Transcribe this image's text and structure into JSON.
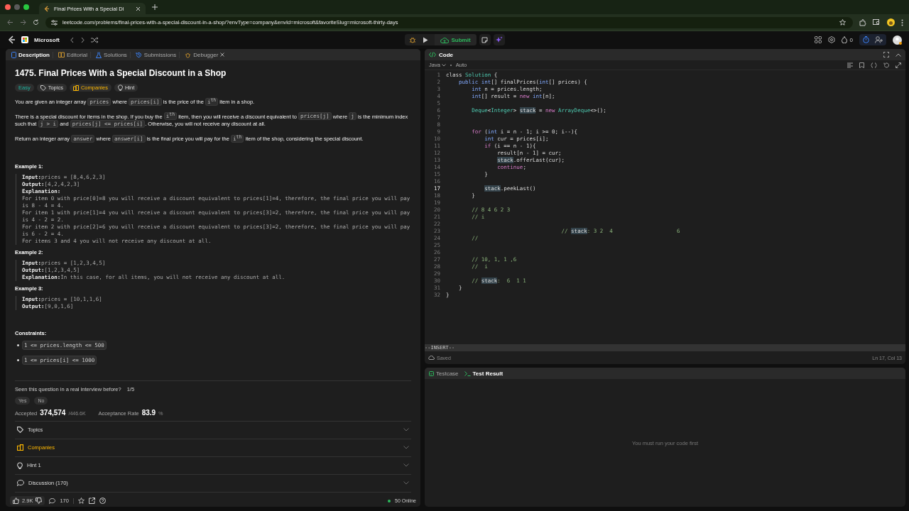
{
  "browser": {
    "tab_title": "Final Prices With a Special Di",
    "url": "leetcode.com/problems/final-prices-with-a-special-discount-in-a-shop/?envType=company&envId=microsoft&favoriteSlug=microsoft-thirty-days"
  },
  "app_bar": {
    "list_name": "Microsoft",
    "submit": "Submit",
    "points": "0"
  },
  "left_tabs": [
    {
      "label": "Description",
      "selected": true,
      "kind": "description"
    },
    {
      "label": "Editorial",
      "selected": false,
      "kind": "editorial"
    },
    {
      "label": "Solutions",
      "selected": false,
      "kind": "solutions"
    },
    {
      "label": "Submissions",
      "selected": false,
      "kind": "submissions"
    },
    {
      "label": "Debugger",
      "selected": false,
      "kind": "debugger"
    }
  ],
  "problem": {
    "title": "1475. Final Prices With a Special Discount in a Shop",
    "difficulty": "Easy",
    "tags": [
      {
        "label": "Topics",
        "kind": "topics"
      },
      {
        "label": "Companies",
        "kind": "companies"
      },
      {
        "label": "Hint",
        "kind": "hint"
      }
    ],
    "paragraphs": [
      [
        {
          "t": "You are given an integer array "
        },
        {
          "t": "prices",
          "code": true
        },
        {
          "t": " where "
        },
        {
          "t": "prices[i]",
          "code": true
        },
        {
          "t": " is the price of the "
        },
        {
          "t": "i$^{th}$",
          "code": true
        },
        {
          "t": " item in a shop."
        }
      ],
      [
        {
          "t": "There is a special discount for items in the shop. If you buy the "
        },
        {
          "t": "i$^{th}$",
          "code": true
        },
        {
          "t": " item, then you will receive a discount equivalent to "
        },
        {
          "t": "prices[j]",
          "code": true
        },
        {
          "t": " where "
        },
        {
          "t": "j",
          "code": true
        },
        {
          "t": " is the minimum index such that "
        },
        {
          "t": "j > i",
          "code": true
        },
        {
          "t": " and "
        },
        {
          "t": "prices[j] <= prices[i]",
          "code": true
        },
        {
          "t": ". Otherwise, you will not receive any discount at all."
        }
      ],
      [
        {
          "t": "Return an integer array "
        },
        {
          "t": "answer",
          "code": true
        },
        {
          "t": " where "
        },
        {
          "t": "answer[i]",
          "code": true
        },
        {
          "t": " is the final price you will pay for the "
        },
        {
          "t": "i$^{th}$",
          "code": true
        },
        {
          "t": " item of the shop, considering the special discount."
        }
      ]
    ],
    "examples": [
      {
        "heading": "Example 1:",
        "lines": [
          {
            "label": "Input:",
            "text": "prices = [8,4,6,2,3]"
          },
          {
            "label": "Output:",
            "text": "[4,2,4,2,3]"
          },
          {
            "label": "Explanation:"
          },
          {
            "text": "For item 0 with price[0]=8 you will receive a discount equivalent to prices[1]=4, therefore, the final price you will pay is 8 - 4 = 4."
          },
          {
            "text": "For item 1 with price[1]=4 you will receive a discount equivalent to prices[3]=2, therefore, the final price you will pay is 4 - 2 = 2."
          },
          {
            "text": "For item 2 with price[2]=6 you will receive a discount equivalent to prices[3]=2, therefore, the final price you will pay is 6 - 2 = 4."
          },
          {
            "text": "For items 3 and 4 you will not receive any discount at all."
          }
        ]
      },
      {
        "heading": "Example 2:",
        "lines": [
          {
            "label": "Input:",
            "text": "prices = [1,2,3,4,5]"
          },
          {
            "label": "Output:",
            "text": "[1,2,3,4,5]"
          },
          {
            "label": "Explanation:",
            "text": "In this case, for all items, you will not receive any discount at all."
          }
        ]
      },
      {
        "heading": "Example 3:",
        "lines": [
          {
            "label": "Input:",
            "text": "prices = [10,1,1,6]"
          },
          {
            "label": "Output:",
            "text": "[9,0,1,6]"
          }
        ]
      }
    ],
    "constraints": {
      "heading": "Constraints:",
      "items": [
        "1 <= prices.length <= 500",
        "1 <= prices[i] <= 1000"
      ]
    },
    "feedback": {
      "question": "Seen this question in a real interview before?",
      "count": "1/5",
      "buttons": [
        "Yes",
        "No"
      ]
    },
    "stats": {
      "accepted_label": "Accepted",
      "accepted": "374,574",
      "submissions": "/446.6K",
      "rate_label": "Acceptance Rate",
      "rate": "83.9",
      "rate_unit": "%"
    },
    "sections": [
      {
        "label": "Topics",
        "kind": "topics"
      },
      {
        "label": "Companies",
        "kind": "companies"
      },
      {
        "label": "Hint 1",
        "kind": "hint"
      },
      {
        "label": "Discussion (170)",
        "kind": "discussion"
      }
    ]
  },
  "bottom_bar": {
    "likes": "2.9K",
    "comments": "170",
    "online": "50 Online"
  },
  "editor": {
    "title": "Code",
    "language": "Java",
    "mode": "Auto",
    "lines": [
      {
        "number": "1",
        "current": false,
        "tokens": [
          {
            "t": "class ",
            "kind": "plain"
          },
          {
            "t": "Solution",
            "kind": "type"
          },
          {
            "t": " {",
            "kind": "plain"
          }
        ]
      },
      {
        "number": "2",
        "current": false,
        "tokens": [
          {
            "t": "    public ",
            "kind": "prim"
          },
          {
            "t": "int",
            "kind": "prim"
          },
          {
            "t": "[] finalPrices(",
            "kind": "plain"
          },
          {
            "t": "int",
            "kind": "prim"
          },
          {
            "t": "[] prices) {",
            "kind": "plain"
          }
        ]
      },
      {
        "number": "3",
        "current": false,
        "tokens": [
          {
            "t": "        int",
            "kind": "prim"
          },
          {
            "t": " n = prices.length;",
            "kind": "plain"
          }
        ]
      },
      {
        "number": "4",
        "current": false,
        "tokens": [
          {
            "t": "        int",
            "kind": "prim"
          },
          {
            "t": "[] result = ",
            "kind": "plain"
          },
          {
            "t": "new ",
            "kind": "kw"
          },
          {
            "t": "int",
            "kind": "prim"
          },
          {
            "t": "[n];",
            "kind": "plain"
          }
        ]
      },
      {
        "number": "5",
        "current": false
      },
      {
        "number": "6",
        "current": false,
        "tokens": [
          {
            "t": "        Deque",
            "kind": "type"
          },
          {
            "t": "<",
            "kind": "plain"
          },
          {
            "t": "Integer",
            "kind": "type"
          },
          {
            "t": "> ",
            "kind": "plain"
          },
          {
            "t": "stack",
            "kind": "hl"
          },
          {
            "t": " = ",
            "kind": "plain"
          },
          {
            "t": "new ",
            "kind": "kw"
          },
          {
            "t": "ArrayDeque",
            "kind": "type"
          },
          {
            "t": "<>();",
            "kind": "plain"
          }
        ]
      },
      {
        "number": "7",
        "current": false
      },
      {
        "number": "8",
        "current": false
      },
      {
        "number": "9",
        "current": false,
        "tokens": [
          {
            "t": "        for",
            "kind": "kw"
          },
          {
            "t": " (",
            "kind": "plain"
          },
          {
            "t": "int",
            "kind": "prim"
          },
          {
            "t": " i = n - 1; i >= 0; i--){",
            "kind": "plain"
          }
        ]
      },
      {
        "number": "10",
        "current": false,
        "tokens": [
          {
            "t": "            int",
            "kind": "prim"
          },
          {
            "t": " cur = prices[i];",
            "kind": "plain"
          }
        ]
      },
      {
        "number": "11",
        "current": false,
        "tokens": [
          {
            "t": "            if",
            "kind": "kw"
          },
          {
            "t": " (i == n - 1){",
            "kind": "plain"
          }
        ]
      },
      {
        "number": "12",
        "current": false,
        "tokens": [
          {
            "t": "                result[n - 1] = cur;",
            "kind": "plain"
          }
        ]
      },
      {
        "number": "13",
        "current": false,
        "tokens": [
          {
            "t": "                stack",
            "kind": "hl"
          },
          {
            "t": ".offerLast(cur);",
            "kind": "plain"
          }
        ]
      },
      {
        "number": "14",
        "current": false,
        "tokens": [
          {
            "t": "                continue",
            "kind": "kw"
          },
          {
            "t": ";",
            "kind": "plain"
          }
        ]
      },
      {
        "number": "15",
        "current": false,
        "tokens": [
          {
            "t": "            }",
            "kind": "plain"
          }
        ]
      },
      {
        "number": "16",
        "current": false
      },
      {
        "number": "17",
        "current": true,
        "tokens": [
          {
            "t": "            stack",
            "kind": "hl"
          },
          {
            "t": ".peekLast()",
            "kind": "plain"
          }
        ]
      },
      {
        "number": "18",
        "current": false,
        "tokens": [
          {
            "t": "        }",
            "kind": "plain"
          }
        ]
      },
      {
        "number": "19",
        "current": false
      },
      {
        "number": "20",
        "current": false,
        "tokens": [
          {
            "t": "        // 8 4 6 2 3",
            "kind": "comment"
          }
        ]
      },
      {
        "number": "21",
        "current": false,
        "tokens": [
          {
            "t": "        // i",
            "kind": "comment"
          }
        ]
      },
      {
        "number": "22",
        "current": false
      },
      {
        "number": "23",
        "current": false,
        "tokens": [
          {
            "t": "                                    // ",
            "kind": "comment"
          },
          {
            "t": "stack",
            "kind": "hl"
          },
          {
            "t": ": 3 2  4                    6",
            "kind": "comment"
          }
        ]
      },
      {
        "number": "24",
        "current": false,
        "tokens": [
          {
            "t": "        //",
            "kind": "comment"
          }
        ]
      },
      {
        "number": "25",
        "current": false
      },
      {
        "number": "26",
        "current": false
      },
      {
        "number": "27",
        "current": false,
        "tokens": [
          {
            "t": "        // 10, 1, 1 ,6",
            "kind": "comment"
          }
        ]
      },
      {
        "number": "28",
        "current": false,
        "tokens": [
          {
            "t": "        //  i",
            "kind": "comment"
          }
        ]
      },
      {
        "number": "29",
        "current": false
      },
      {
        "number": "30",
        "current": false,
        "tokens": [
          {
            "t": "        // ",
            "kind": "comment"
          },
          {
            "t": "stack",
            "kind": "hl"
          },
          {
            "t": ":  6  1 1",
            "kind": "comment"
          }
        ]
      },
      {
        "number": "31",
        "current": false,
        "tokens": [
          {
            "t": "    }",
            "kind": "plain"
          }
        ]
      },
      {
        "number": "32",
        "current": false,
        "tokens": [
          {
            "t": "}",
            "kind": "plain"
          }
        ]
      }
    ],
    "vim_mode": "--INSERT--",
    "saved": "Saved",
    "cursor": "Ln 17, Col 13"
  },
  "test_tabs": [
    {
      "label": "Testcase",
      "selected": false,
      "kind": "testcase"
    },
    {
      "label": "Test Result",
      "selected": true,
      "kind": "result"
    }
  ],
  "test_message": "You must run your code first"
}
